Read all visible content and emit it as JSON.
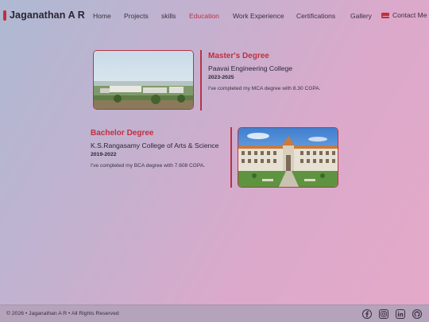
{
  "brand": {
    "name": "Jaganathan A R"
  },
  "nav": {
    "home": "Home",
    "projects": "Projects",
    "skills": "skills",
    "education": "Education",
    "work": "Work Experience",
    "certifications": "Certifications",
    "gallery": "Gallery",
    "contact": "Contact Me"
  },
  "education": [
    {
      "degree": "Master's Degree",
      "college": "Paavai Engineering College",
      "years": "2023-2025",
      "description": "I've completed my MCA degree with 8.30 CGPA."
    },
    {
      "degree": "Bachelor Degree",
      "college": "K.S.Rangasamy College of Arts & Science",
      "years": "2019-2022",
      "description": "I've completed my BCA degree with 7.608 CGPA."
    }
  ],
  "footer": {
    "copyright": "© 2026 • Jaganathan A R • All Rights Reserved",
    "socials": [
      "facebook-icon",
      "instagram-icon",
      "linkedin-icon",
      "github-icon"
    ]
  },
  "colors": {
    "accent": "#c0303f",
    "text": "#2d2735"
  }
}
